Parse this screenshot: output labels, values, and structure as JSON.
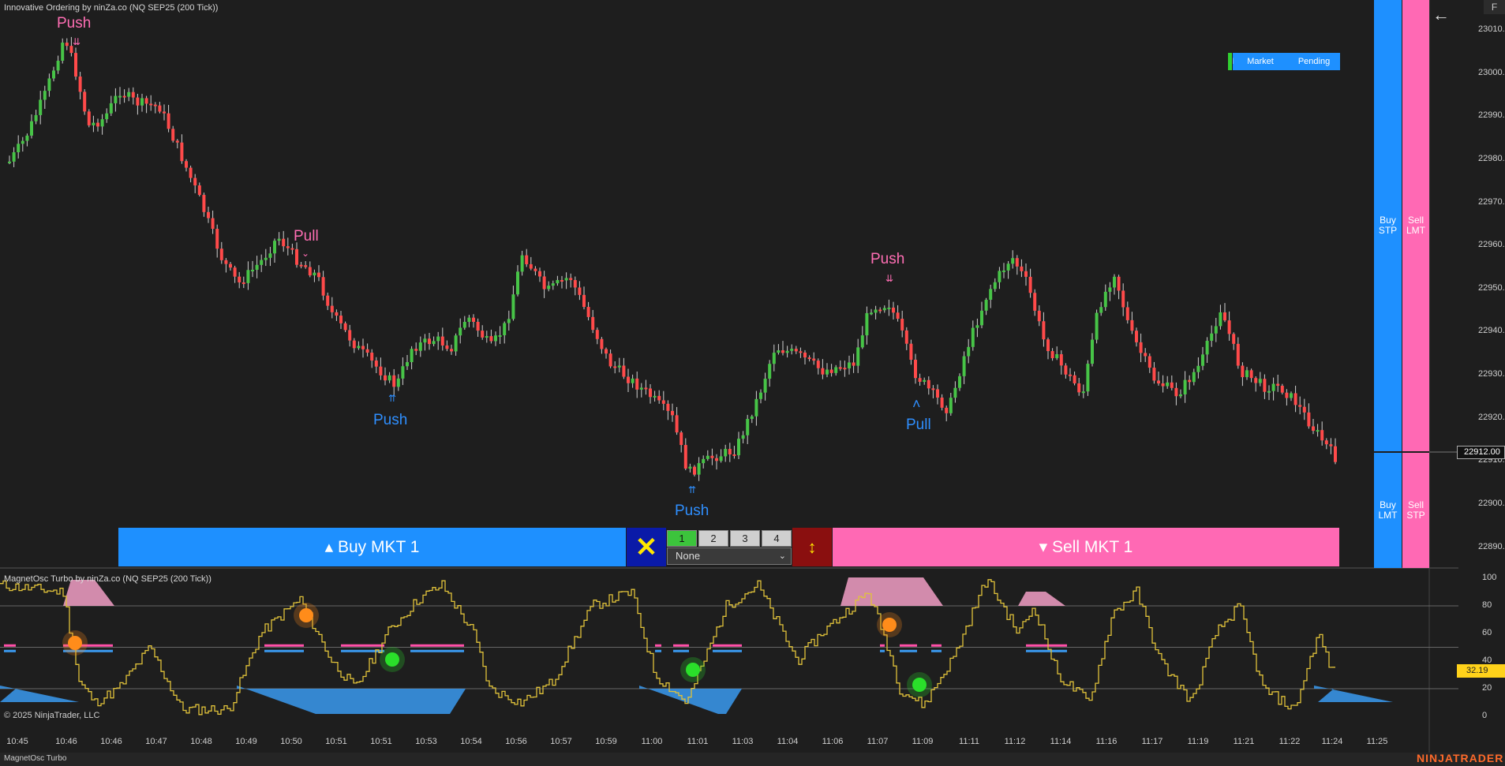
{
  "chart": {
    "title": "Innovative Ordering by ninZa.co (NQ SEP25 (200 Tick))",
    "corner_label": "F",
    "price_ticks": [
      "23010.00",
      "23000.00",
      "22990.00",
      "22980.00",
      "22970.00",
      "22960.00",
      "22950.00",
      "22940.00",
      "22930.00",
      "22920.00",
      "22912.00",
      "22910.00",
      "22900.00",
      "22890.00"
    ],
    "current_price": "22912.00",
    "colors": {
      "up": "#47c447",
      "down": "#ff4a4a",
      "push_up": "#2f8fff",
      "push_down": "#ff6eb4",
      "accent_blue": "#1e90ff",
      "accent_pink": "#ff69b4"
    }
  },
  "signals": [
    {
      "label": "Push",
      "dir": "down"
    },
    {
      "label": "Pull",
      "dir": "down"
    },
    {
      "label": "Push",
      "dir": "up"
    },
    {
      "label": "Push",
      "dir": "up"
    },
    {
      "label": "Push",
      "dir": "down"
    },
    {
      "label": "Pull",
      "dir": "up"
    }
  ],
  "order_panel": {
    "tab_market": "Market",
    "tab_pending": "Pending",
    "buy_label": "▴ Buy MKT 1",
    "sell_label": "▾ Sell MKT 1",
    "close_icon": "close-icon",
    "reverse_icon": "reverse-arrows-icon",
    "qty_options": [
      "1",
      "2",
      "3",
      "4"
    ],
    "selected_qty": "1",
    "atm_select": "None"
  },
  "side_buttons": {
    "buy_stp": "Buy STP",
    "sell_lmt": "Sell LMT",
    "buy_lmt": "Buy LMT",
    "sell_stp": "Sell STP",
    "back_icon": "back-arrow-icon"
  },
  "oscillator": {
    "title": "MagnetOsc Turbo by ninZa.co (NQ SEP25 (200 Tick))",
    "levels": [
      "100",
      "80",
      "60",
      "40",
      "20",
      "0"
    ],
    "current_value": "32.19",
    "copyright": "© 2025 NinjaTrader, LLC"
  },
  "time_axis": [
    "10:45",
    "10:46",
    "10:46",
    "10:47",
    "10:48",
    "10:49",
    "10:50",
    "10:51",
    "10:51",
    "10:53",
    "10:54",
    "10:56",
    "10:57",
    "10:59",
    "11:00",
    "11:01",
    "11:03",
    "11:04",
    "11:06",
    "11:07",
    "11:09",
    "11:11",
    "11:12",
    "11:14",
    "11:16",
    "11:17",
    "11:19",
    "11:21",
    "11:22",
    "11:24",
    "11:25"
  ],
  "footer": {
    "tab_label": "MagnetOsc Turbo",
    "brand": "NINJATRADER"
  }
}
